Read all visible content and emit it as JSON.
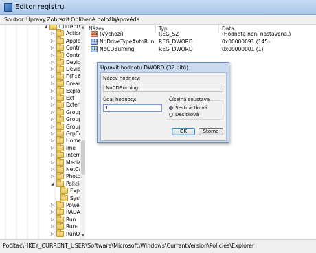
{
  "window": {
    "title": "Editor registru"
  },
  "menu": [
    "Soubor",
    "Úpravy",
    "Zobrazit",
    "Oblíbené položky",
    "Nápověda"
  ],
  "tree": {
    "items": [
      {
        "label": "CurrentVer",
        "expanded": true
      },
      {
        "label": "Action",
        "expanded": false
      },
      {
        "label": "Applet",
        "expanded": false
      },
      {
        "label": "Contro",
        "expanded": false
      },
      {
        "label": "Contro",
        "expanded": false
      },
      {
        "label": "Device",
        "expanded": false
      },
      {
        "label": "Device",
        "expanded": false
      },
      {
        "label": "DIFxAp",
        "expanded": false
      },
      {
        "label": "DreamS",
        "expanded": false
      },
      {
        "label": "Explore",
        "expanded": false
      },
      {
        "label": "Ext",
        "expanded": false
      },
      {
        "label": "Extensic",
        "expanded": false
      },
      {
        "label": "Group I",
        "expanded": false
      },
      {
        "label": "Group I",
        "expanded": false
      },
      {
        "label": "Group I",
        "expanded": false
      },
      {
        "label": "GrpCor",
        "expanded": false
      },
      {
        "label": "HomeC",
        "expanded": false
      },
      {
        "label": "ime",
        "expanded": false
      },
      {
        "label": "Interne",
        "expanded": false
      },
      {
        "label": "Media",
        "expanded": false
      },
      {
        "label": "NetCac",
        "expanded": false
      },
      {
        "label": "Photo A",
        "expanded": false
      },
      {
        "label": "Policies",
        "expanded": true
      },
      {
        "label": "Exp",
        "expanded": false
      },
      {
        "label": "Syst",
        "expanded": false
      },
      {
        "label": "PowerC",
        "expanded": false
      },
      {
        "label": "RADAR",
        "expanded": false
      },
      {
        "label": "Run",
        "expanded": false
      },
      {
        "label": "Run-",
        "expanded": false
      },
      {
        "label": "RunOn",
        "expanded": false
      }
    ]
  },
  "list": {
    "columns": [
      "Název",
      "Typ",
      "Data"
    ],
    "rows": [
      {
        "icon": "string-value-icon",
        "name": "(Výchozí)",
        "type": "REG_SZ",
        "data": "(Hodnota není nastavena.)"
      },
      {
        "icon": "dword-value-icon",
        "name": "NoDriveTypeAutoRun",
        "type": "REG_DWORD",
        "data": "0x00000091 (145)"
      },
      {
        "icon": "dword-value-icon",
        "name": "NoCDBurning",
        "type": "REG_DWORD",
        "data": "0x00000001 (1)"
      }
    ]
  },
  "dialog": {
    "title": "Upravit hodnotu DWORD (32 bitů)",
    "name_label": "Název hodnoty:",
    "name_value": "NoCDBurning",
    "data_label": "Údaj hodnoty:",
    "data_value": "1",
    "base_label": "Číselná soustava",
    "base_options": [
      {
        "label": "Šestnáctková",
        "selected": true
      },
      {
        "label": "Desítková",
        "selected": false
      }
    ],
    "ok_label": "OK",
    "cancel_label": "Storno"
  },
  "status": {
    "path": "Počítač\\HKEY_CURRENT_USER\\Software\\Microsoft\\Windows\\CurrentVersion\\Policies\\Explorer"
  }
}
